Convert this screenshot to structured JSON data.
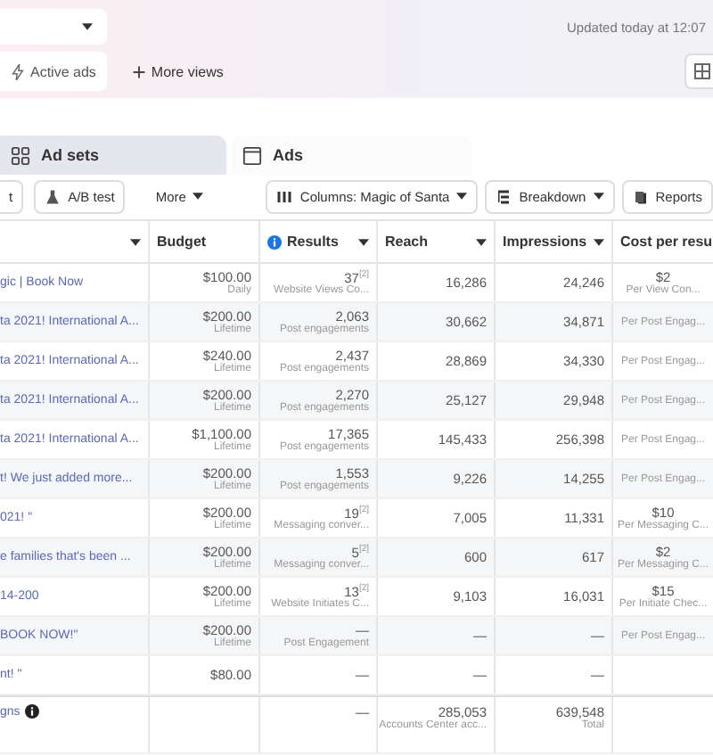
{
  "top": {
    "updated": "Updated today at 12:07"
  },
  "views": [
    {
      "label": "Active ads",
      "kind": "chip",
      "selected": true
    },
    {
      "label": "More views",
      "kind": "add",
      "selected": false
    }
  ],
  "level_tabs": [
    {
      "label": "Ad sets",
      "selected": true
    },
    {
      "label": "Ads",
      "selected": false
    }
  ],
  "toolbar": {
    "left": [
      {
        "label": "t",
        "kind": "button"
      },
      {
        "label": "A/B test",
        "kind": "button"
      },
      {
        "label": "More",
        "kind": "menu"
      }
    ],
    "right": [
      {
        "label": "Columns: Magic of Santa",
        "dropdown": true
      },
      {
        "label": "Breakdown",
        "dropdown": true
      },
      {
        "label": "Reports",
        "dropdown": false
      }
    ]
  },
  "table": {
    "columns": [
      {
        "menu": true
      },
      {
        "label": "Budget",
        "menu": false
      },
      {
        "label": "Results",
        "info": true,
        "menu": true
      },
      {
        "label": "Reach",
        "menu": true
      },
      {
        "label": "Impressions",
        "menu": true
      },
      {
        "label": "Cost per resu"
      }
    ],
    "rows": [
      {
        "cells": [
          {
            "value": "gic | Book Now"
          },
          {
            "value": "$100.00",
            "sub": "Daily"
          },
          {
            "value": "37$^{[2]}$",
            "sub": "Website Views Co..."
          },
          {
            "value": "16,286"
          },
          {
            "value": "24,246"
          },
          {
            "value": "$2",
            "sub": "Per View Con..."
          }
        ]
      },
      {
        "cells": [
          {
            "value": "ta 2021! International A..."
          },
          {
            "value": "$200.00",
            "sub": "Lifetime"
          },
          {
            "value": "2,063",
            "sub": "Post engagements"
          },
          {
            "value": "30,662"
          },
          {
            "value": "34,871"
          },
          {
            "sub": "Per Post Engag..."
          }
        ]
      },
      {
        "cells": [
          {
            "value": "ta 2021! International A..."
          },
          {
            "value": "$240.00",
            "sub": "Lifetime"
          },
          {
            "value": "2,437",
            "sub": "Post engagements"
          },
          {
            "value": "28,869"
          },
          {
            "value": "34,330"
          },
          {
            "sub": "Per Post Engag..."
          }
        ]
      },
      {
        "cells": [
          {
            "value": "ta 2021! International A..."
          },
          {
            "value": "$200.00",
            "sub": "Lifetime"
          },
          {
            "value": "2,270",
            "sub": "Post engagements"
          },
          {
            "value": "25,127"
          },
          {
            "value": "29,948"
          },
          {
            "sub": "Per Post Engag..."
          }
        ]
      },
      {
        "cells": [
          {
            "value": "ta 2021! International A..."
          },
          {
            "value": "$1,100.00",
            "sub": "Lifetime"
          },
          {
            "value": "17,365",
            "sub": "Post engagements"
          },
          {
            "value": "145,433"
          },
          {
            "value": "256,398"
          },
          {
            "sub": "Per Post Engag..."
          }
        ]
      },
      {
        "cells": [
          {
            "value": "t! We just added more..."
          },
          {
            "value": "$200.00",
            "sub": "Lifetime"
          },
          {
            "value": "1,553",
            "sub": "Post engagements"
          },
          {
            "value": "9,226"
          },
          {
            "value": "14,255"
          },
          {
            "sub": "Per Post Engag..."
          }
        ]
      },
      {
        "cells": [
          {
            "value": "021! \""
          },
          {
            "value": "$200.00",
            "sub": "Lifetime"
          },
          {
            "value": "19$^{[2]}$",
            "sub": "Messaging conver..."
          },
          {
            "value": "7,005"
          },
          {
            "value": "11,331"
          },
          {
            "value": "$10",
            "sub": "Per Messaging C..."
          }
        ]
      },
      {
        "cells": [
          {
            "value": "e families that's been ..."
          },
          {
            "value": "$200.00",
            "sub": "Lifetime"
          },
          {
            "value": "5$^{[2]}$",
            "sub": "Messaging conver..."
          },
          {
            "value": "600"
          },
          {
            "value": "617"
          },
          {
            "value": "$2",
            "sub": "Per Messaging C..."
          }
        ]
      },
      {
        "cells": [
          {
            "value": "14-200"
          },
          {
            "value": "$200.00",
            "sub": "Lifetime"
          },
          {
            "value": "13$^{[2]}$",
            "sub": "Website Initiates C..."
          },
          {
            "value": "9,103"
          },
          {
            "value": "16,031"
          },
          {
            "value": "$15",
            "sub": "Per Initiate Chec..."
          }
        ]
      },
      {
        "cells": [
          {
            "value": "BOOK NOW!\""
          },
          {
            "value": "$200.00",
            "sub": "Lifetime"
          },
          {
            "value": "—",
            "sub": "Post Engagement"
          },
          {
            "value": "—"
          },
          {
            "value": "—"
          },
          {
            "sub": "Per Post Engag..."
          }
        ]
      },
      {
        "cells": [
          {
            "value": "nt! \""
          },
          {
            "value": "$80.00"
          },
          {
            "value": "—"
          },
          {
            "value": "—"
          },
          {
            "value": "—"
          },
          {}
        ]
      }
    ],
    "summary": {
      "cells": [
        {
          "value": "gns"
        },
        {},
        {
          "value": "—"
        },
        {
          "value": "285,053",
          "sub": "Accounts Center acc..."
        },
        {
          "value": "639,548",
          "sub": "Total"
        },
        {}
      ]
    }
  }
}
